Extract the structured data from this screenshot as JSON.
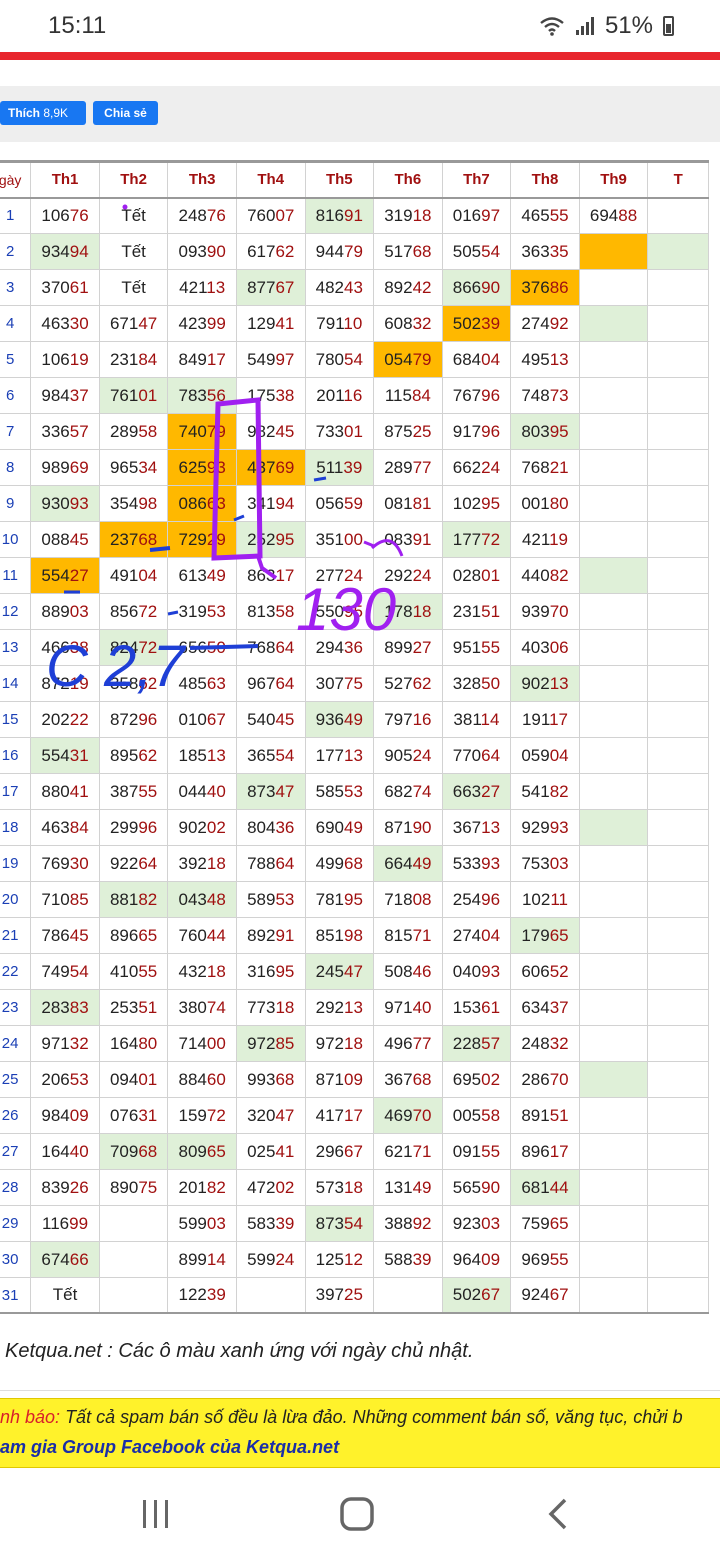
{
  "status": {
    "time": "15:11",
    "battery": "51%"
  },
  "colors": {
    "red_bar": "#e8262d",
    "green_cell": "#dff0d8",
    "orange_cell": "#ffb800",
    "number_red": "#a01010",
    "day_blue": "#1a3fb5",
    "facebook_blue": "#1877f2",
    "warning_yellow": "#fff22b",
    "pen_purple": "#a020f0",
    "pen_blue": "#1e3fd6"
  },
  "social": {
    "like_label": "Thích",
    "like_count": "8,9K",
    "share_label": "Chia sẻ"
  },
  "table": {
    "day_header": "gày",
    "columns": [
      "Th1",
      "Th2",
      "Th3",
      "Th4",
      "Th5",
      "Th6",
      "Th7",
      "Th8",
      "Th9",
      "T"
    ],
    "rows": [
      {
        "day": "1",
        "cells": [
          "10676",
          "Tết",
          "24876",
          "76007",
          "81691",
          "31918",
          "01697",
          "46555",
          "69488",
          ""
        ],
        "green": [
          4
        ],
        "orange": []
      },
      {
        "day": "2",
        "cells": [
          "93494",
          "Tết",
          "09390",
          "61762",
          "94479",
          "51768",
          "50554",
          "36335",
          "",
          ""
        ],
        "green": [
          0,
          9
        ],
        "orange": [
          8
        ]
      },
      {
        "day": "3",
        "cells": [
          "37061",
          "Tết",
          "42113",
          "87767",
          "48243",
          "89242",
          "86690",
          "37686",
          "",
          ""
        ],
        "green": [
          3,
          6
        ],
        "orange": [
          7
        ]
      },
      {
        "day": "4",
        "cells": [
          "46330",
          "67147",
          "42399",
          "12941",
          "79110",
          "60832",
          "50239",
          "27492",
          "",
          ""
        ],
        "green": [
          8
        ],
        "orange": [
          6
        ]
      },
      {
        "day": "5",
        "cells": [
          "10619",
          "23184",
          "84917",
          "54997",
          "78054",
          "05479",
          "68404",
          "49513",
          "",
          ""
        ],
        "green": [],
        "orange": [
          5
        ]
      },
      {
        "day": "6",
        "cells": [
          "98437",
          "76101",
          "78356",
          "17538",
          "20116",
          "11584",
          "76796",
          "74873",
          "",
          ""
        ],
        "green": [
          1,
          2
        ],
        "orange": []
      },
      {
        "day": "7",
        "cells": [
          "33657",
          "28958",
          "74079",
          "98245",
          "73301",
          "87525",
          "91796",
          "80395",
          "",
          ""
        ],
        "green": [
          7
        ],
        "orange": [
          2
        ]
      },
      {
        "day": "8",
        "cells": [
          "98969",
          "96534",
          "62593",
          "43769",
          "51139",
          "28977",
          "66224",
          "76821",
          "",
          ""
        ],
        "green": [
          4
        ],
        "orange": [
          2,
          3
        ]
      },
      {
        "day": "9",
        "cells": [
          "93093",
          "35498",
          "08663",
          "34194",
          "05659",
          "08181",
          "10295",
          "00180",
          "",
          ""
        ],
        "green": [
          0
        ],
        "orange": [
          2
        ]
      },
      {
        "day": "10",
        "cells": [
          "08845",
          "23768",
          "72929",
          "25295",
          "35100",
          "08391",
          "17772",
          "42119",
          "",
          ""
        ],
        "green": [
          3,
          6
        ],
        "orange": [
          1,
          2
        ]
      },
      {
        "day": "11",
        "cells": [
          "55427",
          "49104",
          "61349",
          "86317",
          "27724",
          "29224",
          "02801",
          "44082",
          "",
          ""
        ],
        "green": [
          8
        ],
        "orange": [
          0
        ]
      },
      {
        "day": "12",
        "cells": [
          "88903",
          "85672",
          "31953",
          "81358",
          "55095",
          "17818",
          "23151",
          "93970",
          "",
          ""
        ],
        "green": [
          5
        ],
        "orange": []
      },
      {
        "day": "13",
        "cells": [
          "46638",
          "82472",
          "65650",
          "76864",
          "29436",
          "89927",
          "95155",
          "40306",
          "",
          ""
        ],
        "green": [
          1
        ],
        "orange": []
      },
      {
        "day": "14",
        "cells": [
          "87219",
          "35862",
          "48563",
          "96764",
          "30775",
          "52762",
          "32850",
          "90213",
          "",
          ""
        ],
        "green": [
          7
        ],
        "orange": []
      },
      {
        "day": "15",
        "cells": [
          "20222",
          "87296",
          "01067",
          "54045",
          "93649",
          "79716",
          "38114",
          "19117",
          "",
          ""
        ],
        "green": [
          4
        ],
        "orange": []
      },
      {
        "day": "16",
        "cells": [
          "55431",
          "89562",
          "18513",
          "36554",
          "17713",
          "90524",
          "77064",
          "05904",
          "",
          ""
        ],
        "green": [
          0
        ],
        "orange": []
      },
      {
        "day": "17",
        "cells": [
          "88041",
          "38755",
          "04440",
          "87347",
          "58553",
          "68274",
          "66327",
          "54182",
          "",
          ""
        ],
        "green": [
          3,
          6
        ],
        "orange": []
      },
      {
        "day": "18",
        "cells": [
          "46384",
          "29996",
          "90202",
          "80436",
          "69049",
          "87190",
          "36713",
          "92993",
          "",
          ""
        ],
        "green": [
          8
        ],
        "orange": []
      },
      {
        "day": "19",
        "cells": [
          "76930",
          "92264",
          "39218",
          "78864",
          "49968",
          "66449",
          "53393",
          "75303",
          "",
          ""
        ],
        "green": [
          5
        ],
        "orange": []
      },
      {
        "day": "20",
        "cells": [
          "71085",
          "88182",
          "04348",
          "58953",
          "78195",
          "71808",
          "25496",
          "10211",
          "",
          ""
        ],
        "green": [
          1,
          2
        ],
        "orange": []
      },
      {
        "day": "21",
        "cells": [
          "78645",
          "89665",
          "76044",
          "89291",
          "85198",
          "81571",
          "27404",
          "17965",
          "",
          ""
        ],
        "green": [
          7
        ],
        "orange": []
      },
      {
        "day": "22",
        "cells": [
          "74954",
          "41055",
          "43218",
          "31695",
          "24547",
          "50846",
          "04093",
          "60652",
          "",
          ""
        ],
        "green": [
          4
        ],
        "orange": []
      },
      {
        "day": "23",
        "cells": [
          "28383",
          "25351",
          "38074",
          "77318",
          "29213",
          "97140",
          "15361",
          "63437",
          "",
          ""
        ],
        "green": [
          0
        ],
        "orange": []
      },
      {
        "day": "24",
        "cells": [
          "97132",
          "16480",
          "71400",
          "97285",
          "97218",
          "49677",
          "22857",
          "24832",
          "",
          ""
        ],
        "green": [
          3,
          6
        ],
        "orange": []
      },
      {
        "day": "25",
        "cells": [
          "20653",
          "09401",
          "88460",
          "99368",
          "87109",
          "36768",
          "69502",
          "28670",
          "",
          ""
        ],
        "green": [
          8
        ],
        "orange": []
      },
      {
        "day": "26",
        "cells": [
          "98409",
          "07631",
          "15972",
          "32047",
          "41717",
          "46970",
          "00558",
          "89151",
          "",
          ""
        ],
        "green": [
          5
        ],
        "orange": []
      },
      {
        "day": "27",
        "cells": [
          "16440",
          "70968",
          "80965",
          "02541",
          "29667",
          "62171",
          "09155",
          "89617",
          "",
          ""
        ],
        "green": [
          1,
          2
        ],
        "orange": []
      },
      {
        "day": "28",
        "cells": [
          "83926",
          "89075",
          "20182",
          "47202",
          "57318",
          "13149",
          "56590",
          "68144",
          "",
          ""
        ],
        "green": [
          7
        ],
        "orange": []
      },
      {
        "day": "29",
        "cells": [
          "11699",
          "",
          "59903",
          "58339",
          "87354",
          "38892",
          "92303",
          "75965",
          "",
          ""
        ],
        "green": [
          4
        ],
        "orange": []
      },
      {
        "day": "30",
        "cells": [
          "67466",
          "",
          "89914",
          "59924",
          "12512",
          "58839",
          "96409",
          "96955",
          "",
          ""
        ],
        "green": [
          0
        ],
        "orange": []
      },
      {
        "day": "31",
        "cells": [
          "Tết",
          "",
          "12239",
          "",
          "39725",
          "",
          "50267",
          "92467",
          "",
          ""
        ],
        "green": [
          6
        ],
        "orange": []
      }
    ]
  },
  "footnote": "Ketqua.net : Các ô màu xanh ứng với ngày chủ nhật.",
  "warning": {
    "label": "nh báo:",
    "text": " Tất cả spam bán số đều là lừa đảo. Những comment bán số, văng tục, chửi b",
    "group_link": "am gia Group Facebook của Ketqua.net"
  },
  "annotations": {
    "blue_note": "C 2,7",
    "purple_note": "130"
  }
}
